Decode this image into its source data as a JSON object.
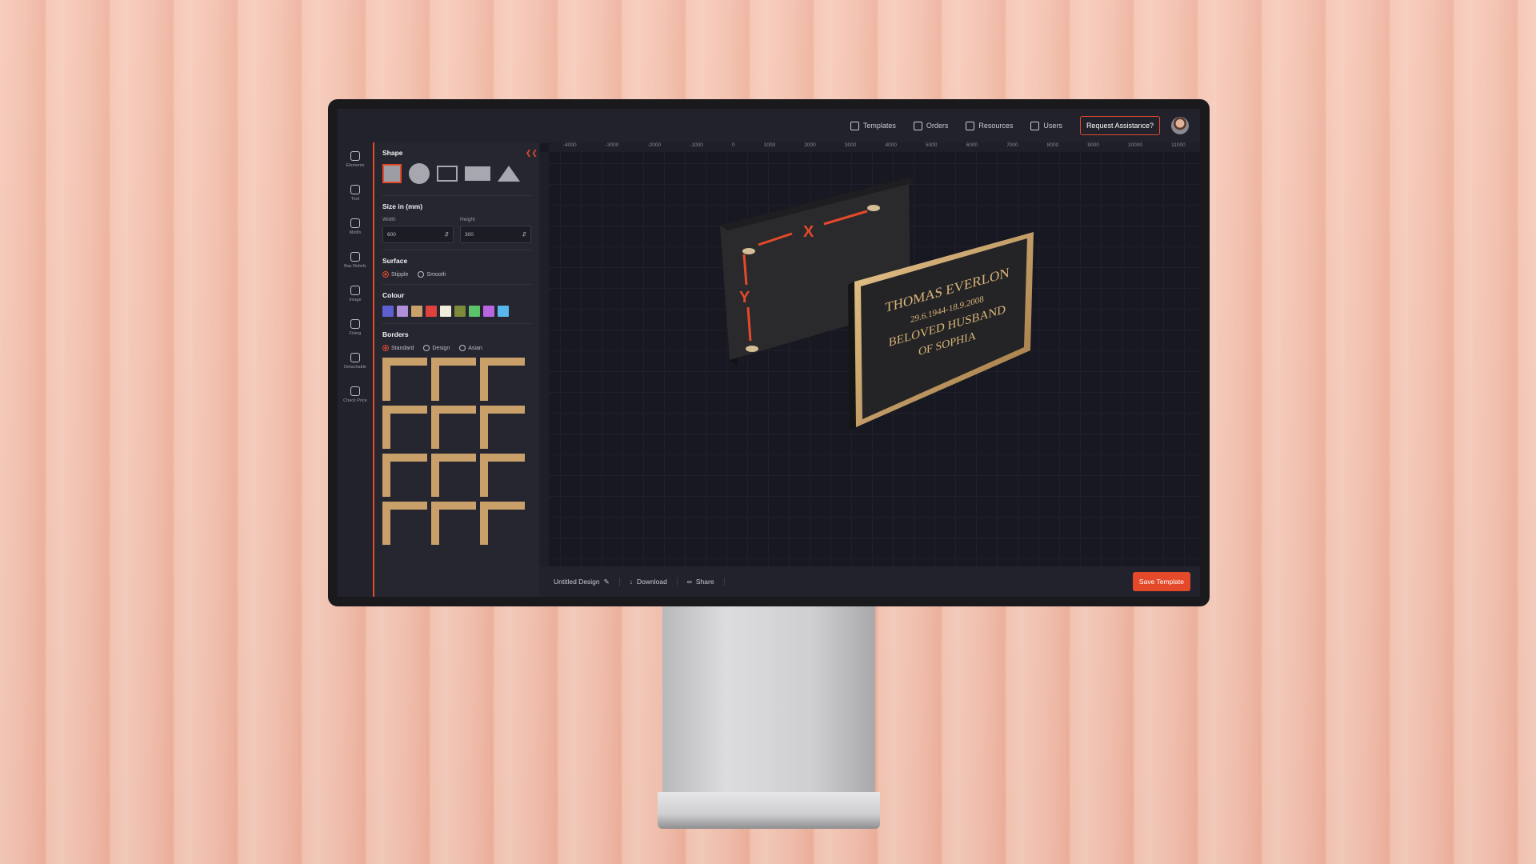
{
  "topnav": {
    "items": [
      {
        "label": "Templates",
        "icon": "document-icon"
      },
      {
        "label": "Orders",
        "icon": "box-icon"
      },
      {
        "label": "Resources",
        "icon": "book-icon"
      },
      {
        "label": "Users",
        "icon": "users-icon"
      }
    ],
    "assist_label": "Request Assistance?"
  },
  "sidebar": {
    "items": [
      {
        "label": "Elements",
        "icon": "elements-icon"
      },
      {
        "label": "Text",
        "icon": "text-icon"
      },
      {
        "label": "Motifs",
        "icon": "motif-icon"
      },
      {
        "label": "Bas Reliefs",
        "icon": "relief-icon"
      },
      {
        "label": "Image",
        "icon": "image-icon"
      },
      {
        "label": "Fixing",
        "icon": "wrench-icon"
      },
      {
        "label": "Detachable",
        "icon": "detachable-icon"
      },
      {
        "label": "Check Price",
        "icon": "price-icon"
      }
    ]
  },
  "panel": {
    "shape_title": "Shape",
    "size_title": "Size in (mm)",
    "width_label": "Width",
    "width_value": "600",
    "height_label": "Height",
    "height_value": "300",
    "surface_title": "Surface",
    "surface_options": [
      "Stipple",
      "Smooth"
    ],
    "surface_selected": "Stipple",
    "colour_title": "Colour",
    "colours": [
      "#5d5fcf",
      "#b18fd8",
      "#c9a06a",
      "#e0413d",
      "#f1edda",
      "#7d8a3a",
      "#5bc46a",
      "#b765e0",
      "#57b7ec"
    ],
    "borders_title": "Borders",
    "border_options": [
      "Standard",
      "Design",
      "Asian"
    ],
    "border_selected": "Standard"
  },
  "canvas": {
    "ruler_ticks": [
      "-4000",
      "-3000",
      "-2000",
      "-1000",
      "0",
      "1000",
      "2000",
      "3000",
      "4000",
      "5000",
      "6000",
      "7000",
      "8000",
      "9000",
      "10000",
      "11000"
    ],
    "x_label": "X",
    "y_label": "Y",
    "plaque_lines": [
      "THOMAS EVERLON",
      "29.6.1944-18.9.2008",
      "BELOVED HUSBAND",
      "OF SOPHIA"
    ]
  },
  "bottombar": {
    "design_name": "Untitled Design",
    "download_label": "Download",
    "share_label": "Share",
    "save_label": "Save Template"
  }
}
